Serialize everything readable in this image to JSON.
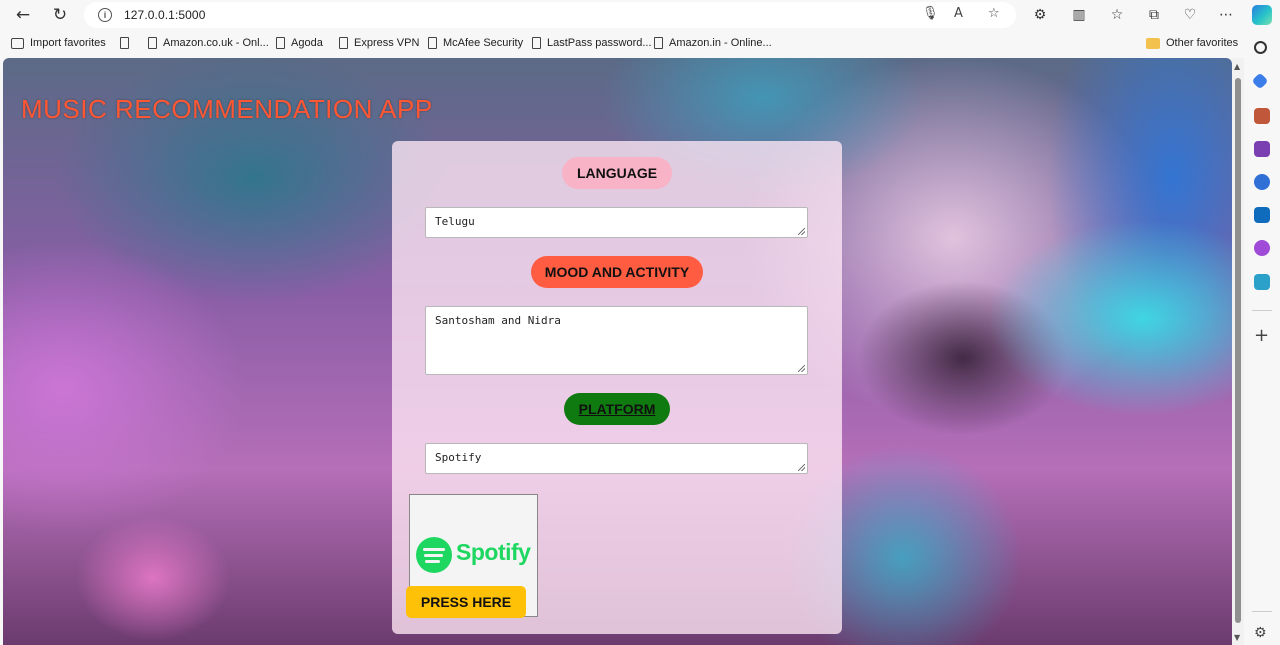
{
  "browser": {
    "url": "127.0.0.1:5000",
    "favorites": [
      {
        "label": "Import favorites",
        "icon": "import-icon"
      },
      {
        "label": "Amazon.co.uk - Onl...",
        "icon": "page-icon"
      },
      {
        "label": "Agoda",
        "icon": "page-icon"
      },
      {
        "label": "Express VPN",
        "icon": "page-icon"
      },
      {
        "label": "McAfee Security",
        "icon": "page-icon"
      },
      {
        "label": "LastPass password...",
        "icon": "page-icon"
      },
      {
        "label": "Amazon.in - Online...",
        "icon": "page-icon"
      }
    ],
    "other_favorites": "Other favorites"
  },
  "app": {
    "title": "MUSIC RECOMMENDATION APP",
    "language": {
      "label": "LANGUAGE",
      "value": "Telugu"
    },
    "mood": {
      "label": "MOOD AND ACTIVITY",
      "value": "Santosham and Nidra"
    },
    "platform": {
      "label": "PLATFORM",
      "value": "Spotify"
    },
    "logo_text": "Spotify",
    "submit_label": "PRESS HERE"
  },
  "colors": {
    "title": "#ff5733",
    "language_pill": "#f8b3c6",
    "mood_pill": "#ff5c41",
    "platform_pill": "#0f7a0f",
    "button": "#ffc107",
    "spotify_green": "#1ed760"
  }
}
